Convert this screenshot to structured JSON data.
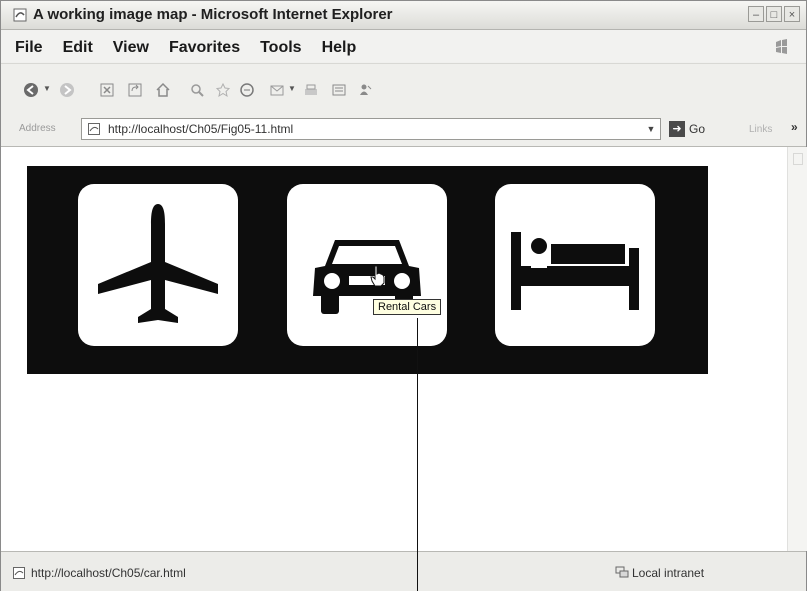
{
  "window": {
    "title": "A working image map - Microsoft Internet Explorer"
  },
  "menubar": {
    "items": [
      "File",
      "Edit",
      "View",
      "Favorites",
      "Tools",
      "Help"
    ]
  },
  "toolbar": {
    "icons": [
      "back-icon",
      "forward-icon",
      "stop-icon",
      "refresh-icon",
      "home-icon",
      "search-icon",
      "favorites-icon",
      "media-icon",
      "mail-icon",
      "print-icon",
      "edit-icon",
      "messenger-icon"
    ]
  },
  "addressbar": {
    "label": "Address",
    "url": "http://localhost/Ch05/Fig05-11.html",
    "go_label": "Go",
    "links_label": "Links",
    "links_arrow": "»"
  },
  "content": {
    "tiles": [
      "airplane-icon",
      "car-icon",
      "bed-icon"
    ],
    "tooltip": "Rental Cars"
  },
  "statusbar": {
    "url": "http://localhost/Ch05/car.html",
    "zone": "Local intranet"
  }
}
